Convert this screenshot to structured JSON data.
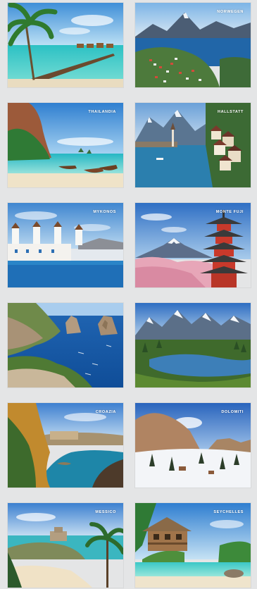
{
  "cards": [
    {
      "name": "maldives",
      "label": ""
    },
    {
      "name": "norway",
      "label": "NORWEGEN"
    },
    {
      "name": "thailand",
      "label": "THAILANDIA"
    },
    {
      "name": "hallstatt",
      "label": "HALLSTATT"
    },
    {
      "name": "mykonos",
      "label": "MYKONOS"
    },
    {
      "name": "mount-fuji",
      "label": "MONTE FUJI"
    },
    {
      "name": "capri",
      "label": ""
    },
    {
      "name": "mountain-lake",
      "label": ""
    },
    {
      "name": "croatia",
      "label": "CROAZIA"
    },
    {
      "name": "dolomiti",
      "label": "DOLOMITI"
    },
    {
      "name": "mexico",
      "label": "MESSICO"
    },
    {
      "name": "seychelles",
      "label": "SEYCHELLES"
    }
  ]
}
